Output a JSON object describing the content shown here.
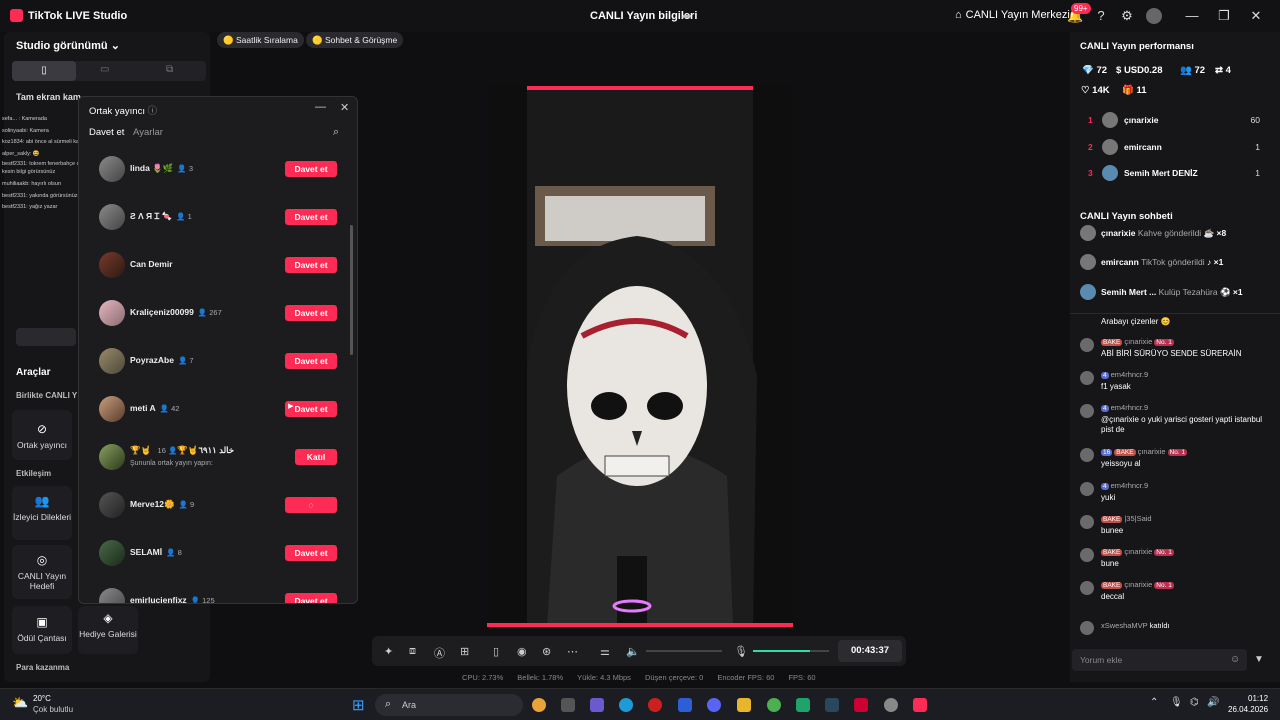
{
  "window": {
    "app_title": "TikTok LIVE Studio",
    "center_title": "CANLI Yayın bilgileri",
    "live_center": "CANLI Yayın Merkezi",
    "notif_badge": "99+"
  },
  "left": {
    "studio_view": "Studio görünümü",
    "fullscreen": "Tam ekran kam",
    "tools_title": "Araçlar",
    "together_live": "Birlikte CANLI Y",
    "interaction": "Etkileşim",
    "earn_money": "Para kazanma",
    "tools": [
      {
        "label": "Ortak yayıncı"
      },
      {
        "label": "İzleyici Dilekleri"
      },
      {
        "label": "CANLI Yayın Hedefi"
      },
      {
        "label": "Ödül Çantası"
      },
      {
        "label": "Hediye Galerisi"
      }
    ],
    "mini_chat": [
      "sefa... : Kamerada",
      "solinyaabi: Kamera",
      "koz1834: abi önce al sürmeli kaisun @bakemaks",
      "alper_sakly: 😆",
      "bestf2331: tokrem fenerbahçe oyuncusu anlaşmış abi yıkmi milyon maaş kesin bilgi görürsünüz",
      "muhiliaakb: hayırlı olsun",
      "bestf2331: yakında görürsünüz abi",
      "bestf2331: yağız yazar"
    ]
  },
  "chips": {
    "ranking": "Saatlik Sıralama",
    "chat_meet": "Sohbet & Görüşme"
  },
  "dialog": {
    "title": "Ortak yayıncı",
    "tab_invite": "Davet et",
    "tab_settings": "Ayarlar",
    "rows": [
      {
        "name": "linda 🌷🌿",
        "count": "3",
        "action": "Davet et"
      },
      {
        "name": "Ƨ Ʌ Я Ɪ 🍬",
        "count": "1",
        "action": "Davet et"
      },
      {
        "name": "Can Demir",
        "count": "",
        "action": "Davet et"
      },
      {
        "name": "Kraliçeniz00099",
        "count": "267",
        "action": "Davet et"
      },
      {
        "name": "PoyrazAbe",
        "count": "7",
        "action": "Davet et"
      },
      {
        "name": "meti A",
        "count": "42",
        "action": "Davet et"
      },
      {
        "name": "🏆🤘 خالد ٦٩١١🤘🏆",
        "count": "16",
        "action": "Katıl",
        "sub": "Şununla ortak yayın yapın:"
      },
      {
        "name": "Merve12🌼",
        "count": "9",
        "action": "loading"
      },
      {
        "name": "SELAMİ",
        "count": "8",
        "action": "Davet et"
      },
      {
        "name": "emirlucienfixz",
        "count": "125",
        "action": "Davet et"
      }
    ]
  },
  "controls": {
    "timer": "00:43:37",
    "volume_level": 0.75
  },
  "stats": {
    "cpu": "CPU: 2.73%",
    "memory": "Bellek: 1.78%",
    "upload": "Yükle: 4.3 Mbps",
    "dropped": "Düşen çerçeve: 0",
    "encoder": "Encoder FPS: 60",
    "fps": "FPS: 60"
  },
  "right": {
    "perf_title": "CANLI Yayın performansı",
    "metrics": {
      "diamonds": "72",
      "usd": "USD0.28",
      "viewers": "72",
      "joined": "4",
      "likes": "14K",
      "gifts": "11"
    },
    "ranking": [
      {
        "n": "1",
        "name": "çınarixie",
        "val": "60"
      },
      {
        "n": "2",
        "name": "emircann",
        "val": "1"
      },
      {
        "n": "3",
        "name": "Semih Mert DENİZ",
        "val": "1"
      }
    ],
    "chat_title": "CANLI Yayın sohbeti",
    "gift_rows": [
      {
        "user": "çınarixie",
        "desc": "Kahve gönderildi",
        "count": "×8"
      },
      {
        "user": "emircann",
        "desc": "TikTok gönderildi",
        "count": "×1"
      },
      {
        "user": "Semih Mert ...",
        "desc": "Kulüp Tezahüra",
        "count": "×1"
      }
    ],
    "messages": [
      {
        "user": "",
        "text": "Arabayı çizenler 😊",
        "badges": ""
      },
      {
        "user": "çınarixie",
        "text": "ABİ BİRİ SÜRÜYO SENDE SÜRERAİN",
        "badges": "BAKE",
        "lvl": "No. 1"
      },
      {
        "user": "em4rhncr.9",
        "text": "f1 yasak",
        "badges": "4"
      },
      {
        "user": "em4rhncr.9",
        "text": "@çınarixie o yuki yarisci gosteri yapti istanbul pist de",
        "badges": "4"
      },
      {
        "user": "çınarixie",
        "text": "yeissoyu al",
        "badges": "16",
        "lvl": "No. 1"
      },
      {
        "user": "em4rhncr.9",
        "text": "yuki",
        "badges": "4"
      },
      {
        "user": "|35|Said",
        "text": "bunee",
        "badges": "BAKE"
      },
      {
        "user": "çınarixie",
        "text": "bune",
        "badges": "BAKE",
        "lvl": "No. 1"
      },
      {
        "user": "çınarixie",
        "text": "deccal",
        "badges": "BAKE",
        "lvl": "No. 1"
      },
      {
        "user": "xSweshaMVP",
        "text": "katıldı",
        "badges": ""
      }
    ],
    "comment_placeholder": "Yorum ekle"
  },
  "taskbar": {
    "temp": "20°C",
    "weather": "Çok bulutlu",
    "search": "Ara",
    "time": "01:12",
    "date": "26.04.2026"
  }
}
